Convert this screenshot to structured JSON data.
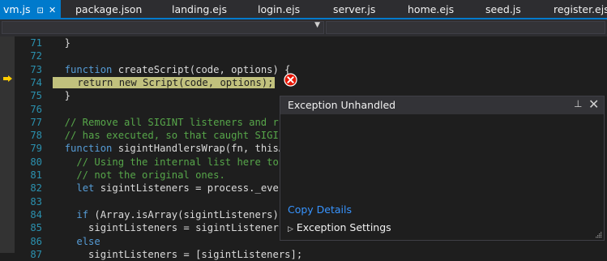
{
  "tabs": [
    {
      "label": "vm.js",
      "active": true
    },
    {
      "label": "package.json"
    },
    {
      "label": "landing.ejs"
    },
    {
      "label": "login.ejs"
    },
    {
      "label": "server.js"
    },
    {
      "label": "home.ejs"
    },
    {
      "label": "seed.js"
    },
    {
      "label": "register.ejs"
    }
  ],
  "active_tab_icons": {
    "pin": "pin-icon",
    "close": "close-icon"
  },
  "colors": {
    "accent": "#007acc",
    "keyword": "#569cd6",
    "comment": "#57a64a",
    "line_number": "#2b91af",
    "current_statement_highlight": "#c1c17d",
    "link": "#3794ff",
    "error": "#e51400"
  },
  "code_lines": [
    {
      "num": "71",
      "text": "  }"
    },
    {
      "num": "72",
      "text": ""
    },
    {
      "num": "73",
      "text": "  function createScript(code, options) {"
    },
    {
      "num": "74",
      "text": "    return new Script(code, options);"
    },
    {
      "num": "75",
      "text": "  }"
    },
    {
      "num": "76",
      "text": ""
    },
    {
      "num": "77",
      "text": "  // Remove all SIGINT listeners and r"
    },
    {
      "num": "78",
      "text": "  // has executed, so that caught SIGI"
    },
    {
      "num": "79",
      "text": "  function sigintHandlersWrap(fn, thisA"
    },
    {
      "num": "80",
      "text": "    // Using the internal list here to"
    },
    {
      "num": "81",
      "text": "    // not the original ones."
    },
    {
      "num": "82",
      "text": "    let sigintListeners = process._eve"
    },
    {
      "num": "83",
      "text": ""
    },
    {
      "num": "84",
      "text": "    if (Array.isArray(sigintListeners)"
    },
    {
      "num": "85",
      "text": "      sigintListeners = sigintListener"
    },
    {
      "num": "86",
      "text": "    else"
    },
    {
      "num": "87",
      "text": "      sigintListeners = [sigintListeners];"
    }
  ],
  "exception_popup": {
    "title": "Exception Unhandled",
    "copy_details": "Copy Details",
    "settings": "Exception Settings"
  }
}
